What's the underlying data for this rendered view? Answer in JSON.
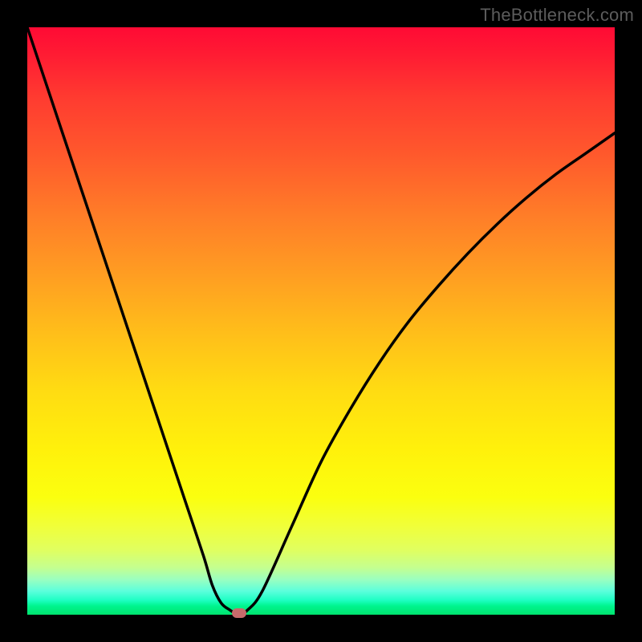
{
  "watermark": "TheBottleneck.com",
  "colors": {
    "frame": "#000000",
    "gradient_top": "#ff0a34",
    "gradient_bottom": "#00e36e",
    "curve": "#000000",
    "marker": "#c76b6b",
    "watermark_text": "#5c5c5c"
  },
  "chart_data": {
    "type": "line",
    "title": "",
    "xlabel": "",
    "ylabel": "",
    "xlim": [
      0,
      100
    ],
    "ylim": [
      0,
      100
    ],
    "grid": false,
    "legend": false,
    "series": [
      {
        "name": "bottleneck-curve",
        "x": [
          0,
          3,
          6,
          9,
          12,
          15,
          18,
          21,
          24,
          27,
          30,
          31.5,
          33,
          34.5,
          36,
          37.5,
          40,
          45,
          50,
          55,
          60,
          65,
          70,
          75,
          80,
          85,
          90,
          95,
          100
        ],
        "values": [
          100,
          91,
          82,
          73,
          64,
          55,
          46,
          37,
          28,
          19,
          10,
          5,
          2,
          0.8,
          0,
          0.8,
          4,
          15,
          26,
          35,
          43,
          50,
          56,
          61.5,
          66.5,
          71,
          75,
          78.5,
          82
        ]
      }
    ],
    "minimum_marker": {
      "x": 36,
      "y": 0
    },
    "notes": "V-shaped bottleneck curve over a vertical traffic-light gradient; minimum near x≈36 touching the bottom (green). Values are percentages estimated from pixel positions."
  }
}
